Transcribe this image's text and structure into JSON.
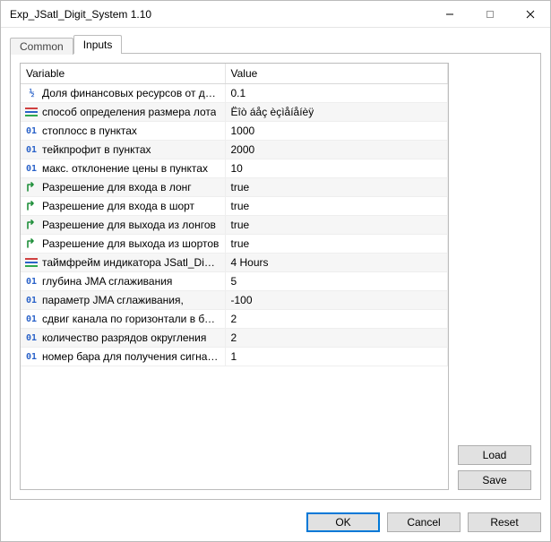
{
  "window": {
    "title": "Exp_JSatl_Digit_System 1.10"
  },
  "tabs": {
    "items": [
      {
        "label": "Common",
        "active": false
      },
      {
        "label": "Inputs",
        "active": true
      }
    ]
  },
  "grid": {
    "headers": {
      "variable": "Variable",
      "value": "Value"
    },
    "rows": [
      {
        "icon": "frac",
        "name": "Доля финансовых ресурсов от депоз...",
        "value": "0.1"
      },
      {
        "icon": "enum",
        "name": "способ определения размера лота",
        "value": "Ëîò áåç èçìåíåíèÿ"
      },
      {
        "icon": "int",
        "name": "стоплосс в пунктах",
        "value": "1000"
      },
      {
        "icon": "int",
        "name": "тейкпрофит в пунктах",
        "value": "2000"
      },
      {
        "icon": "int",
        "name": "макс. отклонение цены в пунктах",
        "value": "10"
      },
      {
        "icon": "bool",
        "name": "Разрешение для входа в лонг",
        "value": "true"
      },
      {
        "icon": "bool",
        "name": "Разрешение для входа в шорт",
        "value": "true"
      },
      {
        "icon": "bool",
        "name": "Разрешение для выхода из лонгов",
        "value": "true"
      },
      {
        "icon": "bool",
        "name": "Разрешение для выхода из шортов",
        "value": "true"
      },
      {
        "icon": "enum",
        "name": "таймфрейм индикатора JSatl_Digit_Sy...",
        "value": "4 Hours"
      },
      {
        "icon": "int",
        "name": "глубина JMA сглаживания",
        "value": "5"
      },
      {
        "icon": "int",
        "name": "параметр JMA сглаживания,",
        "value": "-100"
      },
      {
        "icon": "int",
        "name": "сдвиг канала по горизонтали в барах",
        "value": "2"
      },
      {
        "icon": "int",
        "name": "количество разрядов округления",
        "value": "2"
      },
      {
        "icon": "int",
        "name": "номер бара для получения сигнала в...",
        "value": "1"
      }
    ]
  },
  "buttons": {
    "load": "Load",
    "save": "Save",
    "ok": "OK",
    "cancel": "Cancel",
    "reset": "Reset"
  }
}
